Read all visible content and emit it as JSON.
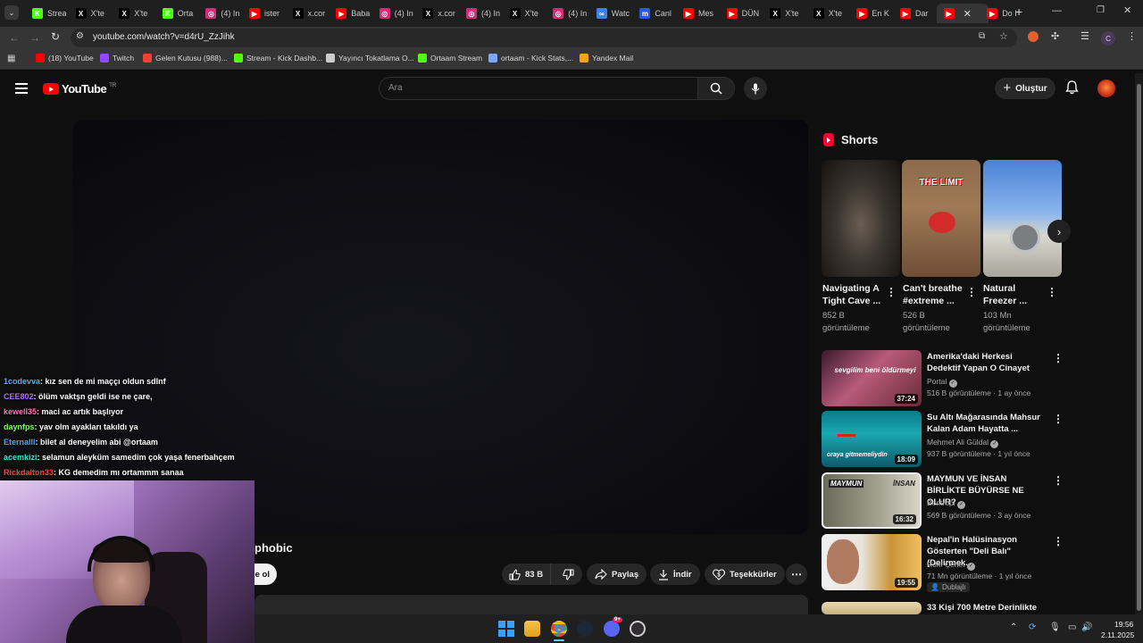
{
  "browser": {
    "tabs": [
      {
        "label": "Strea",
        "color": "#53fc18",
        "glyph": "K"
      },
      {
        "label": "X'te",
        "color": "#000000",
        "glyph": "X"
      },
      {
        "label": "X'te",
        "color": "#000000",
        "glyph": "X"
      },
      {
        "label": "Orta",
        "color": "#53fc18",
        "glyph": "K"
      },
      {
        "label": "(4) In",
        "color": "#d62976",
        "glyph": "◎"
      },
      {
        "label": "ister",
        "color": "#ff0000",
        "glyph": "▶"
      },
      {
        "label": "x.cor",
        "color": "#000000",
        "glyph": "X"
      },
      {
        "label": "Baba",
        "color": "#ff0000",
        "glyph": "▶"
      },
      {
        "label": "(4) In",
        "color": "#d62976",
        "glyph": "◎"
      },
      {
        "label": "x.cor",
        "color": "#000000",
        "glyph": "X"
      },
      {
        "label": "(4) In",
        "color": "#d62976",
        "glyph": "◎"
      },
      {
        "label": "X'te",
        "color": "#000000",
        "glyph": "X"
      },
      {
        "label": "(4) In",
        "color": "#d62976",
        "glyph": "◎"
      },
      {
        "label": "Watc",
        "color": "#3b82f6",
        "glyph": "∞"
      },
      {
        "label": "Canl",
        "color": "#2a5bd7",
        "glyph": "m"
      },
      {
        "label": "Mes",
        "color": "#ff0000",
        "glyph": "▶"
      },
      {
        "label": "DÜN",
        "color": "#ff0000",
        "glyph": "▶"
      },
      {
        "label": "X'te",
        "color": "#000000",
        "glyph": "X"
      },
      {
        "label": "X'te",
        "color": "#000000",
        "glyph": "X"
      },
      {
        "label": "En K",
        "color": "#ff0000",
        "glyph": "▶"
      },
      {
        "label": "Dar",
        "color": "#ff0000",
        "glyph": "▶"
      },
      {
        "label": "",
        "color": "#ff0000",
        "glyph": "▶"
      },
      {
        "label": "Do I",
        "color": "#ff0000",
        "glyph": "▶"
      }
    ],
    "new_tab": "+",
    "close_tab": "✕",
    "url": "youtube.com/watch?v=d4rU_ZzJihk",
    "profile_initial": "C",
    "bookmarks": [
      {
        "label": "(18) YouTube",
        "color": "#ff0000"
      },
      {
        "label": "Twitch",
        "color": "#9146ff"
      },
      {
        "label": "Gelen Kutusu (988)...",
        "color": "#ea4335"
      },
      {
        "label": "Stream - Kick Dashb...",
        "color": "#53fc18"
      },
      {
        "label": "Yayıncı Tokatlama O...",
        "color": "#cccccc"
      },
      {
        "label": "Ortaam Stream",
        "color": "#53fc18"
      },
      {
        "label": "ortaam - Kick Stats,...",
        "color": "#7aa6ff"
      },
      {
        "label": "Yandex Mail",
        "color": "#f7a11a"
      }
    ]
  },
  "yt": {
    "logo_text": "YouTube",
    "logo_sup": "TR",
    "search_placeholder": "Ara",
    "create_label": "Oluştur",
    "video_title_fragment": "phobic",
    "subscribe_fragment": "e ol",
    "like_count": "83 B",
    "share_label": "Paylaş",
    "download_label": "İndir",
    "thanks_label": "Teşekkürler",
    "shorts_heading": "Shorts",
    "shorts": [
      {
        "title": "Navigating A Tight Cave ...",
        "views": "852 B görüntüleme"
      },
      {
        "title": "Can't breathe #extreme ...",
        "views": "526 B görüntüleme",
        "overlay": "THE LIMIT"
      },
      {
        "title": "Natural Freezer ...",
        "views": "103 Mn görüntüleme"
      }
    ],
    "videos": [
      {
        "title": "Amerika'daki Herkesi Dedektif Yapan O Cinayet",
        "channel": "Portal",
        "meta": "516 B görüntüleme · 1 ay önce",
        "duration": "37:24",
        "thumb_text": "sevgilim beni öldürmeyi"
      },
      {
        "title": "Su Altı Mağarasında Mahsur Kalan Adam Hayatta ...",
        "channel": "Mehmet Ali Güldal",
        "meta": "937 B görüntüleme · 1 yıl önce",
        "duration": "18:09",
        "thumb_text": "oraya gitmemeliydin"
      },
      {
        "title": "MAYMUN VE İNSAN BİRLİKTE BÜYÜRSE NE OLUR?",
        "channel": "Bentropi",
        "meta": "569 B görüntüleme · 3 ay önce",
        "duration": "16:32",
        "thumb_text_left": "MAYMUN",
        "thumb_text_right": "İNSAN"
      },
      {
        "title": "Nepal'in Halüsinasyon Gösterten \"Deli Balı\" (Delirmek...",
        "channel": "Ruhi Çenet",
        "meta": "71 Mn görüntüleme · 1 yıl önce",
        "duration": "19:55",
        "badge": "Dublajlı"
      },
      {
        "title": "33 Kişi 700 Metre Derinlikte",
        "channel": "",
        "meta": "",
        "duration": ""
      }
    ]
  },
  "stream_chat": [
    {
      "user": "1codevva",
      "msg": ": kız sen de mi maççı oldun sdlnf",
      "color": "#5aa9ff"
    },
    {
      "user": "CEE802",
      "msg": ": ölüm vaktşn geldi ise ne çare,",
      "color": "#b06cff"
    },
    {
      "user": "kewell35",
      "msg": ": maci ac artık başlıyor",
      "color": "#ff6fb0"
    },
    {
      "user": "daynfps",
      "msg": ": yav olm ayakları takıldı ya",
      "color": "#7dff5a"
    },
    {
      "user": "Eternalll",
      "msg": ": bilet al deneyelim abi @ortaam",
      "color": "#4aa3ff"
    },
    {
      "user": "acemkizi",
      "msg": ": selamun aleyküm samedim çok yaşa fenerbahçem",
      "color": "#3fe0d0"
    },
    {
      "user": "Rickdalton33",
      "msg": ": KG demedim mı ortammm sanaa",
      "color": "#ff4040"
    }
  ],
  "taskbar": {
    "time": "19:56",
    "date": "2.11.2025",
    "discord_badge": "9+"
  }
}
